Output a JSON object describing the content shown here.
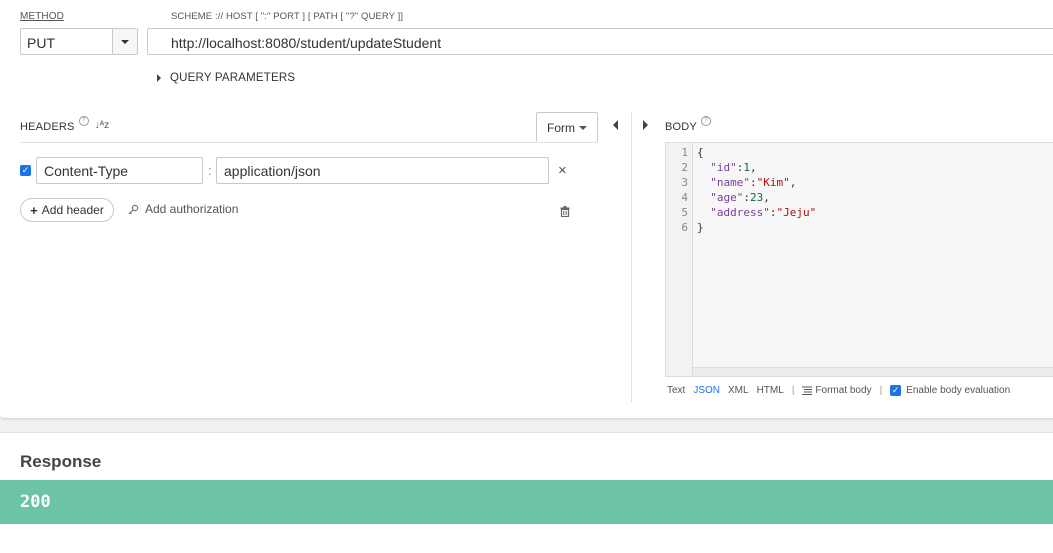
{
  "request": {
    "method_label": "METHOD",
    "method_value": "PUT",
    "url_hint": "SCHEME :// HOST [ \":\" PORT ] [ PATH [ \"?\" QUERY ]]",
    "url_value": "http://localhost:8080/student/updateStudent",
    "query_params_label": "QUERY PARAMETERS"
  },
  "headers": {
    "title": "HEADERS",
    "help_glyph": "?",
    "sort_glyph": "↓ᴬz",
    "form_label": "Form",
    "rows": [
      {
        "checked": true,
        "name": "Content-Type",
        "separator": ":",
        "value": "application/json",
        "remove_glyph": "×"
      }
    ],
    "add_header_label": "Add header",
    "add_header_plus": "+",
    "add_auth_label": "Add authorization"
  },
  "body": {
    "title": "BODY",
    "help_glyph": "?",
    "line_numbers": [
      "1",
      "2",
      "3",
      "4",
      "5",
      "6"
    ],
    "code_lines": [
      {
        "punct": "{"
      },
      {
        "key": "\"id\"",
        "colon": ":",
        "value": "1",
        "value_type": "number",
        "trail": ","
      },
      {
        "key": "\"name\"",
        "colon": ":",
        "value": "\"Kim\"",
        "value_type": "string",
        "trail": ","
      },
      {
        "key": "\"age\"",
        "colon": ":",
        "value": "23",
        "value_type": "number",
        "trail": ","
      },
      {
        "key": "\"address\"",
        "colon": ":",
        "value": "\"Jeju\"",
        "value_type": "string",
        "trail": ""
      },
      {
        "punct": "}"
      }
    ],
    "format_options": [
      "Text",
      "JSON",
      "XML",
      "HTML"
    ],
    "active_format": "JSON",
    "separator": "|",
    "format_body_label": "Format body",
    "enable_eval_label": "Enable body evaluation",
    "enable_eval_checked": true
  },
  "response": {
    "title": "Response",
    "status_code": "200"
  },
  "colors": {
    "accent": "#1a73e8",
    "status_ok": "#6cc3a6"
  }
}
